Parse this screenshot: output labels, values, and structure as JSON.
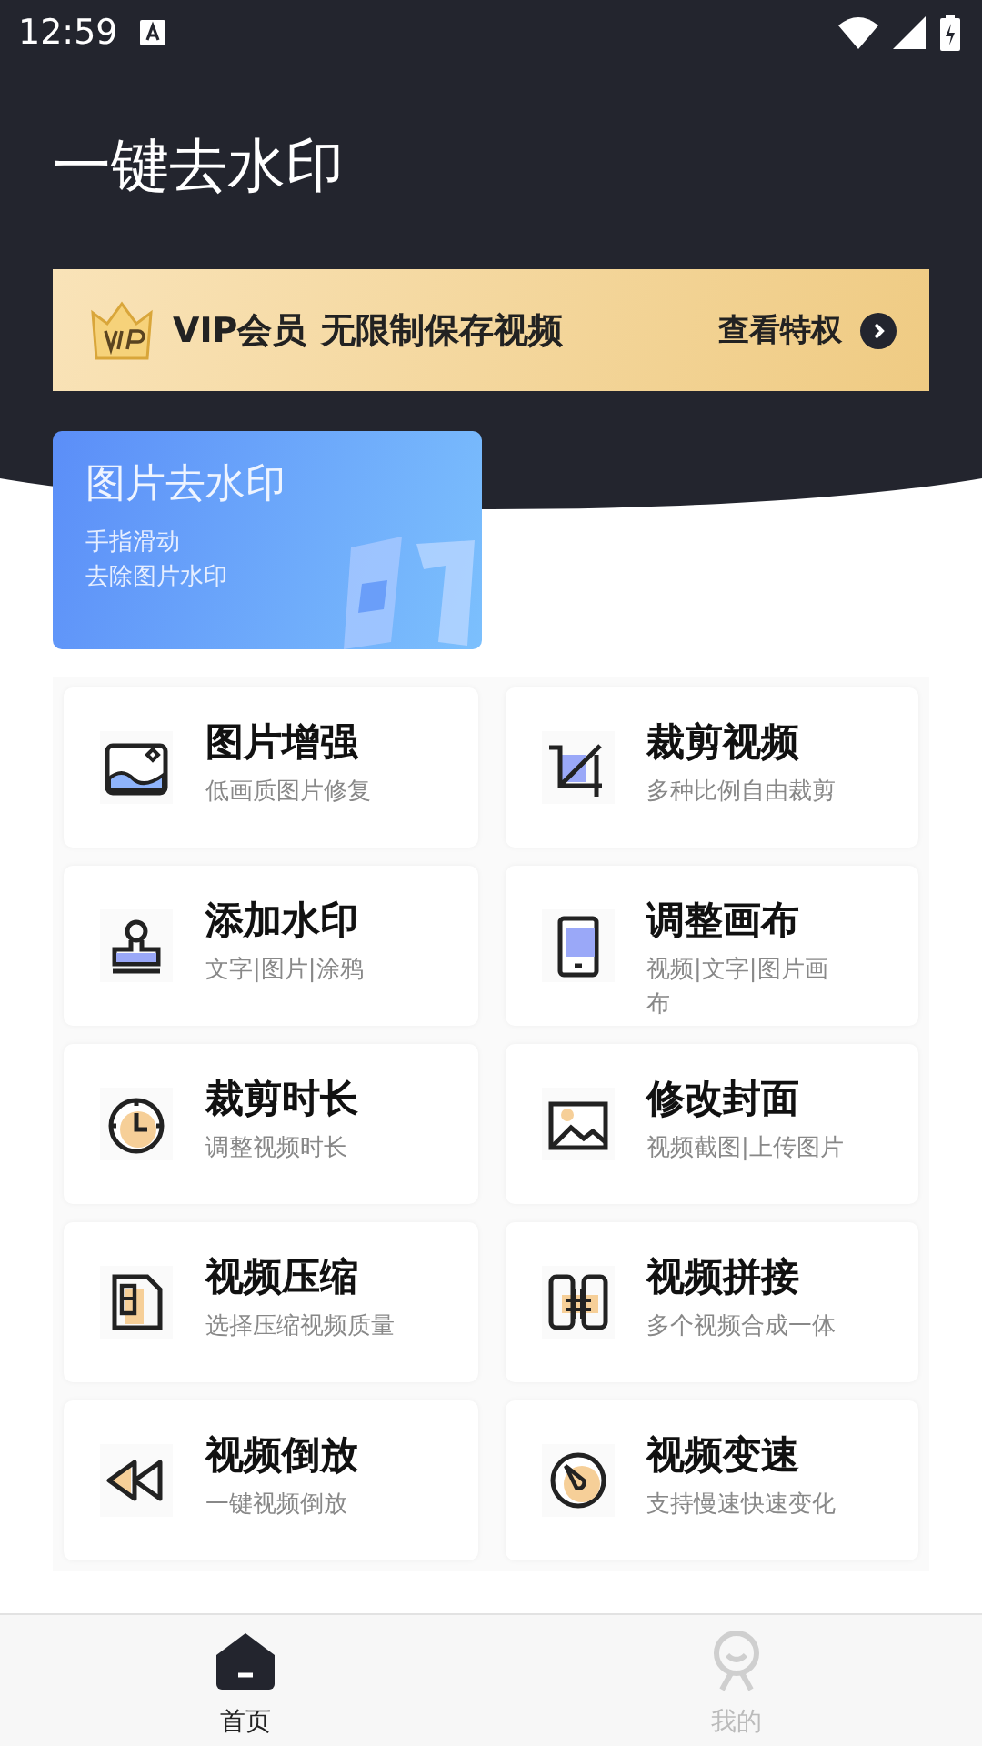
{
  "status_bar": {
    "time": "12:59"
  },
  "header": {
    "title": "一键去水印"
  },
  "vip_banner": {
    "label": "VIP会员",
    "text": "无限制保存视频",
    "action": "查看特权"
  },
  "feature_card": {
    "title": "图片去水印",
    "subtitle_lines": [
      "手指滑动",
      "去除图片水印"
    ]
  },
  "tools": [
    {
      "kind": "image",
      "title": "图片增强",
      "subtitle": "低画质图片修复"
    },
    {
      "kind": "crop",
      "title": "裁剪视频",
      "subtitle": "多种比例自由裁剪"
    },
    {
      "kind": "stamp",
      "title": "添加水印",
      "subtitle": "文字|图片|涂鸦"
    },
    {
      "kind": "tablet",
      "title": "调整画布",
      "subtitle": "视频|文字|图片画布"
    },
    {
      "kind": "clock",
      "title": "裁剪时长",
      "subtitle": "调整视频时长"
    },
    {
      "kind": "picture",
      "title": "修改封面",
      "subtitle": "视频截图|上传图片"
    },
    {
      "kind": "compress",
      "title": "视频压缩",
      "subtitle": "选择压缩视频质量"
    },
    {
      "kind": "merge",
      "title": "视频拼接",
      "subtitle": "多个视频合成一体"
    },
    {
      "kind": "rewind",
      "title": "视频倒放",
      "subtitle": "一键视频倒放"
    },
    {
      "kind": "speed",
      "title": "视频变速",
      "subtitle": "支持慢速快速变化"
    }
  ],
  "bottom_nav": [
    {
      "kind": "home",
      "label": "首页",
      "selected": true
    },
    {
      "kind": "profile",
      "label": "我的",
      "selected": false
    }
  ]
}
